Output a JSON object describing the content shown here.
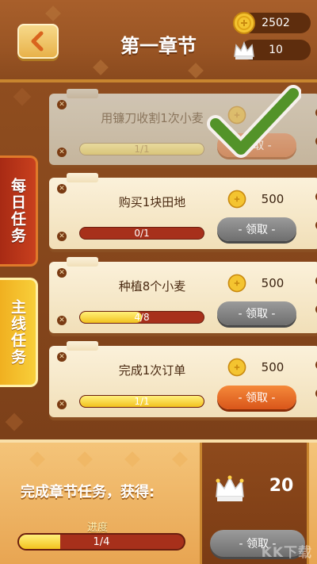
{
  "header": {
    "title": "第一章节",
    "back_icon": "chevron-left-icon",
    "coins": "2502",
    "crowns": "10"
  },
  "tabs": {
    "daily": "每日任务",
    "main": "主线任务",
    "active": "main"
  },
  "quests": [
    {
      "name": "用镰刀收割1次小麦",
      "reward": "",
      "progress_text": "1/1",
      "progress": 1.0,
      "claim": "领取 -",
      "state": "claimed"
    },
    {
      "name": "购买1块田地",
      "reward": "500",
      "progress_text": "0/1",
      "progress": 0.0,
      "claim": "- 领取 -",
      "state": "locked"
    },
    {
      "name": "种植8个小麦",
      "reward": "500",
      "progress_text": "4/8",
      "progress": 0.5,
      "claim": "- 领取 -",
      "state": "locked"
    },
    {
      "name": "完成1次订单",
      "reward": "500",
      "progress_text": "1/1",
      "progress": 1.0,
      "claim": "- 领取 -",
      "state": "ready"
    }
  ],
  "chapter": {
    "label": "完成章节任务，获得:",
    "progress_label": "进度",
    "progress_text": "1/4",
    "progress": 0.25,
    "reward": "20",
    "claim": "- 领取 -"
  },
  "watermark": "KK下载",
  "colors": {
    "accent_orange": "#e06a22",
    "progress_red": "#a7301b",
    "progress_yellow": "#f2c21e",
    "gray_button": "#7e7e7e"
  }
}
